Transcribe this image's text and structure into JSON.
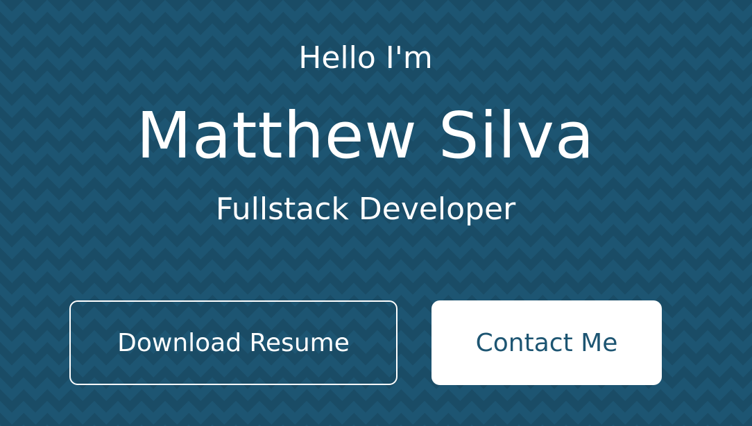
{
  "hero": {
    "greeting": "Hello I'm",
    "name": "Matthew Silva",
    "role": "Fullstack Developer",
    "buttons": {
      "download_resume": "Download Resume",
      "contact_me": "Contact Me"
    }
  },
  "colors": {
    "background": "#1d5572",
    "text": "#ffffff",
    "button_solid_text": "#1d5572",
    "button_solid_background": "#ffffff"
  }
}
